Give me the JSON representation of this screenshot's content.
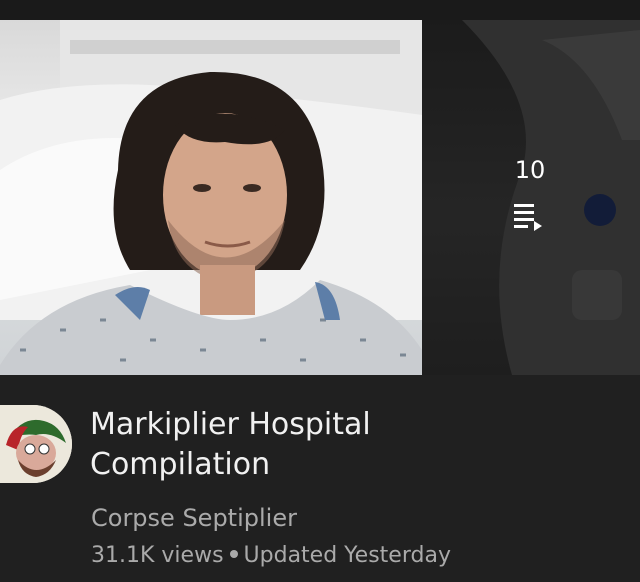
{
  "playlist": {
    "title_line1": "Markiplier Hospital",
    "title_line2": "Compilation",
    "channel": "Corpse Septiplier",
    "views": "31.1K views",
    "updated": "Updated Yesterday",
    "video_count": "10",
    "icons": {
      "playlist": "playlist-play-icon",
      "avatar": "channel-avatar"
    }
  },
  "colors": {
    "background": "#202020",
    "title": "#f1f1f1",
    "secondary_text": "#aaaaaa"
  }
}
